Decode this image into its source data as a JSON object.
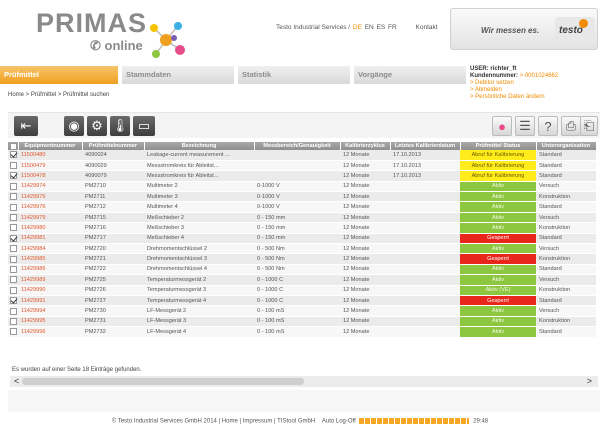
{
  "brand": {
    "name": "PRIMAS",
    "sub": "online"
  },
  "toplinks": {
    "company": "Testo Industrial Services /",
    "lang_de": "DE",
    "lang_en": "EN",
    "lang_es": "ES",
    "lang_fr": "FR",
    "contact": "Kontakt"
  },
  "slogan": {
    "text": "Wir messen es.",
    "brand": "testo"
  },
  "nav": {
    "tabs": [
      "Prüfmittel",
      "Stammdaten",
      "Statistik",
      "Vorgänge"
    ],
    "active": "Prüfmittel"
  },
  "user": {
    "user_label": "USER: richter_ft",
    "kunde_label": "Kundennummer:",
    "kunde_value": "> 0001024662",
    "links": [
      "> Debitor setzen",
      "> Abmelden",
      "> Persönliche Daten ändern"
    ]
  },
  "breadcrumb": "Home > Prüfmittel > Prüfmittel suchen",
  "toolbar": {
    "left": [
      "back-icon",
      "eye-icon",
      "gear-nodes-icon",
      "thermometer-icon",
      "calibrate-icon"
    ],
    "right": [
      "color-palette-icon",
      "list-icon",
      "help-icon",
      "print-icon",
      "export-icon"
    ]
  },
  "table": {
    "headers": [
      "",
      "Equipmentnummer",
      "Prüfmittelnummer",
      "Bezeichnung",
      "Messbereich/Genauigkeit",
      "Kalibrierzyklus",
      "Letztes Kalibrierdatum",
      "Prüfmittel Status",
      "Unterorganisation"
    ],
    "rows": [
      {
        "checked": true,
        "equip": "11500480",
        "pm": "4090024",
        "bez": "Leakage-current measurement ...",
        "mess": "",
        "zyklus": "12 Monate",
        "datum": "17.10.2013",
        "status": "Abruf für Kalibrierung",
        "kind": "abruf",
        "org": "Standard"
      },
      {
        "checked": false,
        "equip": "11500479",
        "pm": "4090029",
        "bez": "Messstromkreis für Ableitst...",
        "mess": "",
        "zyklus": "12 Monate",
        "datum": "17.10.2013",
        "status": "Abruf für Kalibrierung",
        "kind": "abruf",
        "org": "Standard"
      },
      {
        "checked": true,
        "equip": "11500478",
        "pm": "4090079",
        "bez": "Messstromkreis für Ableitst...",
        "mess": "",
        "zyklus": "12 Monate",
        "datum": "17.10.2013",
        "status": "Abruf für Kalibrierung",
        "kind": "abruf",
        "org": "Standard"
      },
      {
        "checked": false,
        "equip": "11429974",
        "pm": "PM2710",
        "bez": "Multimeter 2",
        "mess": "0-1000 V",
        "zyklus": "12 Monate",
        "datum": "",
        "status": "Aktiv",
        "kind": "aktiv",
        "org": "Versuch"
      },
      {
        "checked": false,
        "equip": "11429975",
        "pm": "PM2711",
        "bez": "Multimeter 3",
        "mess": "0-1000 V",
        "zyklus": "12 Monate",
        "datum": "",
        "status": "Aktiv",
        "kind": "aktiv",
        "org": "Konstruktion"
      },
      {
        "checked": false,
        "equip": "11429976",
        "pm": "PM2712",
        "bez": "Multimeter 4",
        "mess": "0-1000 V",
        "zyklus": "12 Monate",
        "datum": "",
        "status": "Aktiv",
        "kind": "aktiv",
        "org": "Standard"
      },
      {
        "checked": false,
        "equip": "11429979",
        "pm": "PM2715",
        "bez": "Meßschieber 2",
        "mess": "0 - 150 mm",
        "zyklus": "12 Monate",
        "datum": "",
        "status": "Aktiv",
        "kind": "aktiv",
        "org": "Versuch"
      },
      {
        "checked": false,
        "equip": "11429980",
        "pm": "PM2716",
        "bez": "Meßschieber 3",
        "mess": "0 - 150 mm",
        "zyklus": "12 Monate",
        "datum": "",
        "status": "Aktiv",
        "kind": "aktiv",
        "org": "Konstruktion"
      },
      {
        "checked": true,
        "equip": "11429981",
        "pm": "PM2717",
        "bez": "Meßschieber 4",
        "mess": "0 - 150 mm",
        "zyklus": "12 Monate",
        "datum": "",
        "status": "Gesperrt",
        "kind": "gesperrt",
        "org": "Standard"
      },
      {
        "checked": false,
        "equip": "11429984",
        "pm": "PM2720",
        "bez": "Drehmomentschlüssel 2",
        "mess": "0 - 500 Nm",
        "zyklus": "12 Monate",
        "datum": "",
        "status": "Aktiv",
        "kind": "aktiv",
        "org": "Versuch"
      },
      {
        "checked": false,
        "equip": "11429985",
        "pm": "PM2721",
        "bez": "Drehmomentschlüssel 3",
        "mess": "0 - 500 Nm",
        "zyklus": "12 Monate",
        "datum": "",
        "status": "Gesperrt",
        "kind": "gesperrt",
        "org": "Konstruktion"
      },
      {
        "checked": false,
        "equip": "11429986",
        "pm": "PM2722",
        "bez": "Drehmomentschlüssel 4",
        "mess": "0 - 500 Nm",
        "zyklus": "12 Monate",
        "datum": "",
        "status": "Aktiv",
        "kind": "aktiv",
        "org": "Standard"
      },
      {
        "checked": false,
        "equip": "11429989",
        "pm": "PM2725",
        "bez": "Temperaturmessgerät 2",
        "mess": "0 - 1000 C",
        "zyklus": "12 Monate",
        "datum": "",
        "status": "Aktiv",
        "kind": "aktiv",
        "org": "Versuch"
      },
      {
        "checked": false,
        "equip": "11429990",
        "pm": "PM2726",
        "bez": "Temperaturmessgerät 3",
        "mess": "0 - 1000 C",
        "zyklus": "12 Monate",
        "datum": "",
        "status": "Aktiv (VE)",
        "kind": "aktiv",
        "org": "Konstruktion"
      },
      {
        "checked": true,
        "equip": "11429991",
        "pm": "PM2727",
        "bez": "Temperaturmessgerät 4",
        "mess": "0 - 1000 C",
        "zyklus": "12 Monate",
        "datum": "",
        "status": "Gesperrt",
        "kind": "gesperrt",
        "org": "Standard"
      },
      {
        "checked": false,
        "equip": "11429994",
        "pm": "PM2730",
        "bez": "LF-Messgerät 2",
        "mess": "0 - 100 mS",
        "zyklus": "12 Monate",
        "datum": "",
        "status": "Aktiv",
        "kind": "aktiv",
        "org": "Versuch"
      },
      {
        "checked": false,
        "equip": "11429995",
        "pm": "PM2731",
        "bez": "LF-Messgerät 3",
        "mess": "0 - 100 mS",
        "zyklus": "12 Monate",
        "datum": "",
        "status": "Aktiv",
        "kind": "aktiv",
        "org": "Konstruktion"
      },
      {
        "checked": false,
        "equip": "11429996",
        "pm": "PM2732",
        "bez": "LF-Messgerät 4",
        "mess": "0 - 100 mS",
        "zyklus": "12 Monate",
        "datum": "",
        "status": "Aktiv",
        "kind": "aktiv",
        "org": "Standard"
      }
    ]
  },
  "result_msg": "Es wurden auf einer Seite 18 Einträge gefunden.",
  "scroll": {
    "left": "<",
    "right": ">"
  },
  "footer": {
    "copyright": "© Testo Industrial Services GmbH 2014",
    "home": "Home",
    "impressum": "Impressum",
    "tistool": "TIStool GmbH",
    "logoff_label": "Auto Log-Off",
    "logoff_time": "29:48"
  },
  "colors": {
    "accent": "#f08c00",
    "aktiv": "#8dc63f",
    "gesperrt": "#e8261c",
    "abruf": "#ffec1a"
  }
}
